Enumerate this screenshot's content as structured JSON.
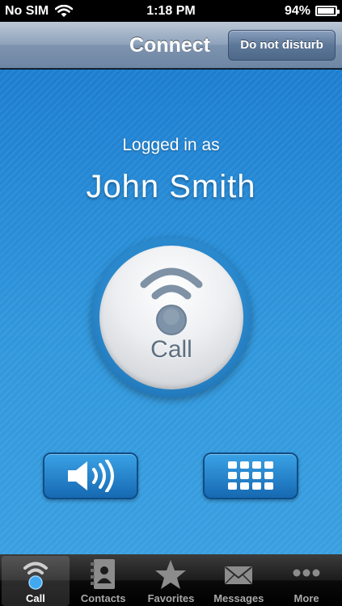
{
  "status_bar": {
    "carrier": "No SIM",
    "time": "1:18 PM",
    "battery_percent": "94%",
    "battery_level": 0.94
  },
  "nav_bar": {
    "title": "Connect",
    "dnd_label": "Do not disturb"
  },
  "main": {
    "logged_in_label": "Logged in as",
    "user_name": "John Smith",
    "call_label": "Call",
    "speaker_icon": "speaker-icon",
    "keypad_icon": "keypad-icon"
  },
  "tabs": [
    {
      "label": "Call",
      "icon": "call-wave-icon",
      "active": true
    },
    {
      "label": "Contacts",
      "icon": "contacts-icon",
      "active": false
    },
    {
      "label": "Favorites",
      "icon": "star-icon",
      "active": false
    },
    {
      "label": "Messages",
      "icon": "envelope-icon",
      "active": false
    },
    {
      "label": "More",
      "icon": "more-dots-icon",
      "active": false
    }
  ],
  "colors": {
    "accent_blue": "#2e8fd6",
    "active_tab_icon": "#41a8f0"
  }
}
